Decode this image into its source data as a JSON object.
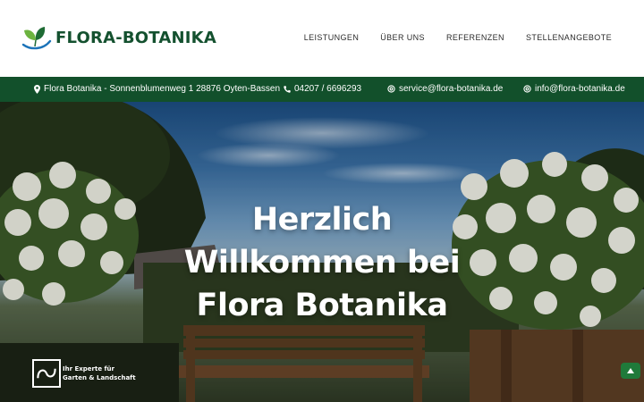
{
  "brand": {
    "name": "FLORA-BOTANIKA",
    "logo": "leaf-logo-icon"
  },
  "nav": {
    "items": [
      "LEISTUNGEN",
      "ÜBER UNS",
      "REFERENZEN",
      "STELLENANGEBOTE"
    ]
  },
  "infobar": {
    "address": "Flora Botanika - Sonnenblumenweg 1 28876 Oyten-Bassen",
    "phone": "04207 / 6696293",
    "service_email": "service@flora-botanika.de",
    "info_email": "info@flora-botanika.de",
    "icons": [
      "map-pin-icon",
      "phone-icon",
      "at-icon",
      "at-icon"
    ]
  },
  "hero": {
    "title_lines": [
      "Herzlich",
      "Willkommen bei",
      "Flora Botanika"
    ],
    "badge_lines": [
      "Ihr Experte für",
      "Garten & Landschaft"
    ]
  },
  "colors": {
    "brand_green": "#14512f",
    "bar_green": "#12502b",
    "button_green": "#1f7a3a"
  }
}
